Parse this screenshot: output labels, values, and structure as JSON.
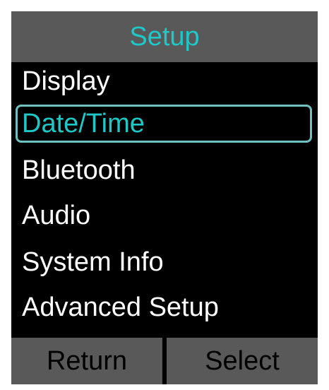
{
  "colors": {
    "screen_background": "#000000",
    "bar_background": "#595959",
    "accent": "#1fc7c7",
    "item_text": "#ffffff",
    "softkey_text": "#000000",
    "selection_outline": "#6fc0c0"
  },
  "header": {
    "title": "Setup"
  },
  "menu": {
    "selected_index": 1,
    "items": [
      {
        "label": "Display"
      },
      {
        "label": "Date/Time"
      },
      {
        "label": "Bluetooth"
      },
      {
        "label": "Audio"
      },
      {
        "label": "System Info"
      },
      {
        "label": "Advanced Setup"
      }
    ]
  },
  "softkeys": {
    "left_label": "Return",
    "right_label": "Select"
  }
}
